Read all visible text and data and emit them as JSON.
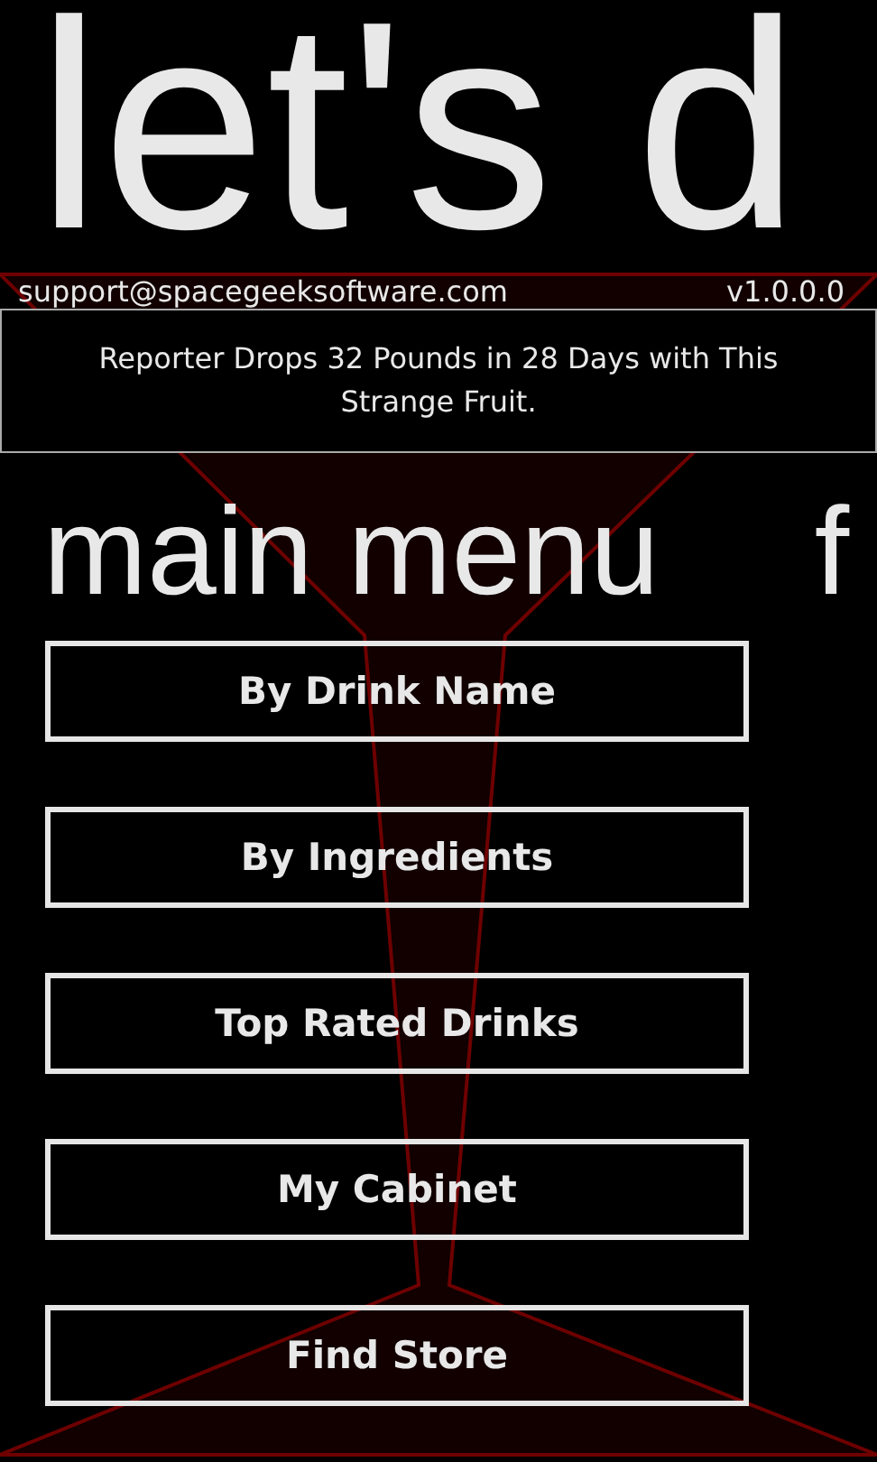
{
  "app_title": "let's d",
  "contact": {
    "email": "support@spacegeeksoftware.com",
    "version": "v1.0.0.0"
  },
  "ad_banner": "Reporter Drops 32 Pounds in 28 Days with This Strange Fruit.",
  "pivot_headers": [
    "main menu",
    "f"
  ],
  "menu_buttons": [
    "By Drink Name",
    "By Ingredients",
    "Top Rated Drinks",
    "My Cabinet",
    "Find Store"
  ]
}
